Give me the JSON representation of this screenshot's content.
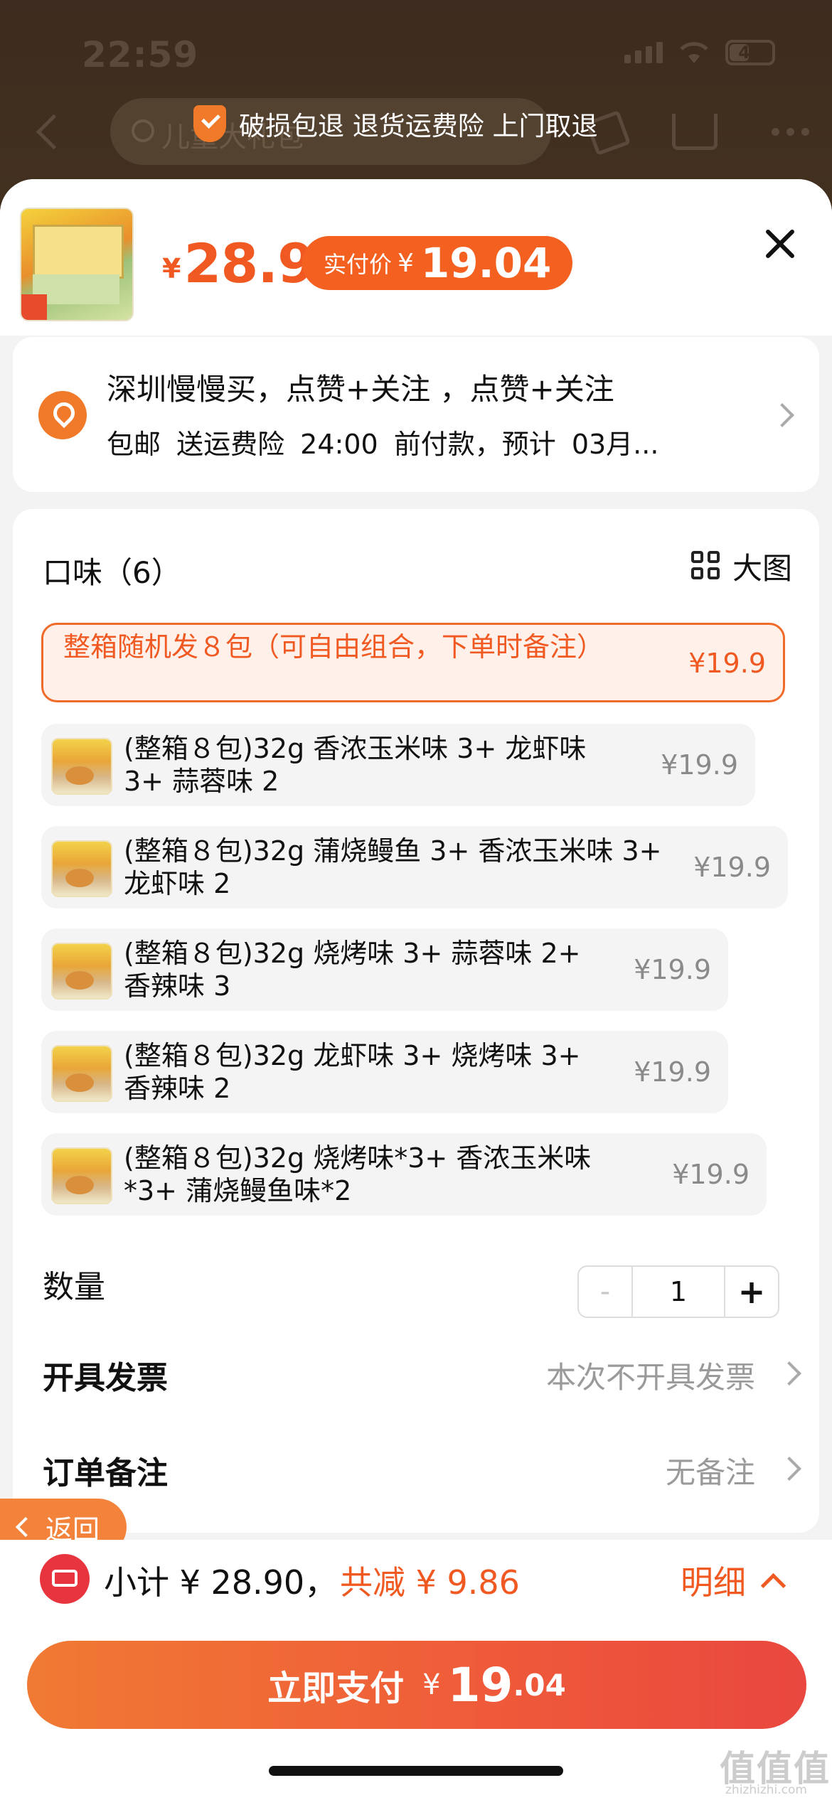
{
  "status": {
    "time": "22:59",
    "battery": "45"
  },
  "nav": {
    "search_placeholder": "儿童大礼包"
  },
  "assurance": {
    "text": "破损包退 退货运费险 上门取退"
  },
  "product": {
    "currency": "¥",
    "price": "28.9",
    "actual_label": "实付价",
    "actual_currency": "¥",
    "actual_price": "19.04"
  },
  "address": {
    "line1": "深圳慢慢买，点赞+关注 ，点赞+关注",
    "line2": "包邮  送运费险  24:00 前付款，预计 03月..."
  },
  "flavor": {
    "title": "口味（6）",
    "big_image_label": "大图",
    "options": [
      {
        "label": "整箱随机发８包（可自由组合，下单时备注）",
        "price": "¥19.9",
        "selected": true
      },
      {
        "label": "(整箱８包)32g 香浓玉米味 3+ 龙虾味 3+ 蒜蓉味 2",
        "price": "¥19.9"
      },
      {
        "label": "(整箱８包)32g 蒲烧鳗鱼 3+ 香浓玉米味 3+ 龙虾味 2",
        "price": "¥19.9"
      },
      {
        "label": "(整箱８包)32g 烧烤味 3+ 蒜蓉味 2+ 香辣味 3",
        "price": "¥19.9"
      },
      {
        "label": "(整箱８包)32g 龙虾味 3+ 烧烤味 3+ 香辣味 2",
        "price": "¥19.9"
      },
      {
        "label": "(整箱８包)32g 烧烤味*3+ 香浓玉米味*3+ 蒲烧鳗鱼味*2",
        "price": "¥19.9"
      }
    ]
  },
  "quantity": {
    "label": "数量",
    "minus": "-",
    "value": "1",
    "plus": "+"
  },
  "invoice": {
    "label": "开具发票",
    "value": "本次不开具发票"
  },
  "remark": {
    "label": "订单备注",
    "value": "无备注"
  },
  "back": {
    "label": "返回"
  },
  "summary": {
    "subtotal": "小计 ¥ 28.90，",
    "discount": "共减 ¥ 9.86",
    "detail_label": "明细"
  },
  "pay": {
    "label": "立即支付",
    "currency": "¥",
    "amount_int": "19",
    "amount_dec": ".04"
  },
  "watermark": {
    "main": "值值值",
    "sub": "zhizhizhi.com"
  },
  "colors": {
    "accent": "#f05a22",
    "pay_gradient_start": "#f07a33",
    "pay_gradient_end": "#e9473f"
  }
}
